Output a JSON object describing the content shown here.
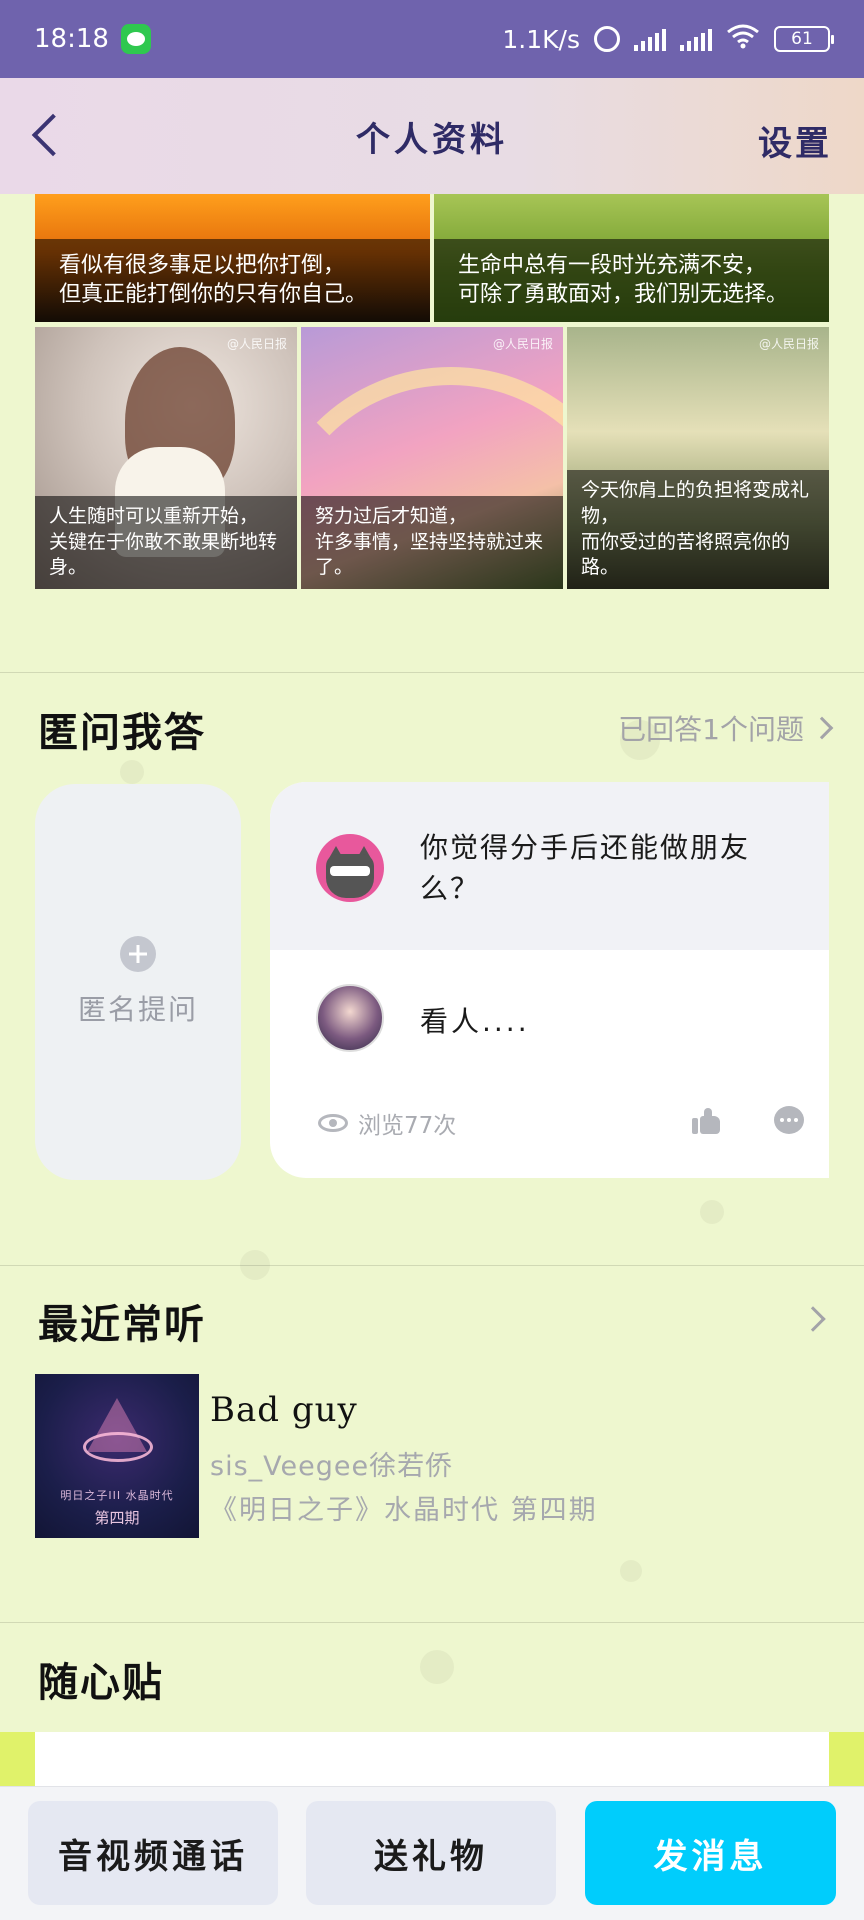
{
  "status_bar": {
    "time": "18:18",
    "net_speed": "1.1K/s",
    "battery": "61"
  },
  "header": {
    "title": "个人资料",
    "settings_label": "设置"
  },
  "photos": [
    {
      "caption": "看似有很多事足以把你打倒，\n但真正能打倒你的只有你自己。"
    },
    {
      "caption": "生命中总有一段时光充满不安，\n可除了勇敢面对，我们别无选择。"
    },
    {
      "caption": "人生随时可以重新开始，\n关键在于你敢不敢果断地转身。",
      "mark": "@人民日报"
    },
    {
      "caption": "努力过后才知道，\n许多事情，坚持坚持就过来了。",
      "mark": "@人民日报"
    },
    {
      "caption": "今天你肩上的负担将变成礼物，\n而你受过的苦将照亮你的路。",
      "mark": "@人民日报"
    }
  ],
  "qa_section": {
    "title": "匿问我答",
    "answered_link": "已回答1个问题",
    "ask_label": "匿名提问",
    "question": "你觉得分手后还能做朋友么？",
    "answer": "看人....",
    "views": "浏览77次"
  },
  "recent_section": {
    "title": "最近常听",
    "song_title": "Bad guy",
    "artist": "sis_Veegee徐若侨",
    "album": "《明日之子》水晶时代 第四期",
    "cover_subtitle": "明日之子III  水晶时代",
    "cover_issue": "第四期"
  },
  "notes_section": {
    "title": "随心贴"
  },
  "bottom_bar": {
    "call_label": "音视频通话",
    "gift_label": "送礼物",
    "message_label": "发消息"
  },
  "colors": {
    "status_bar": "#6f63ad",
    "page_background": "#eef7cf",
    "message_button": "#00cdfc",
    "secondary_button": "#e5e8f2"
  }
}
